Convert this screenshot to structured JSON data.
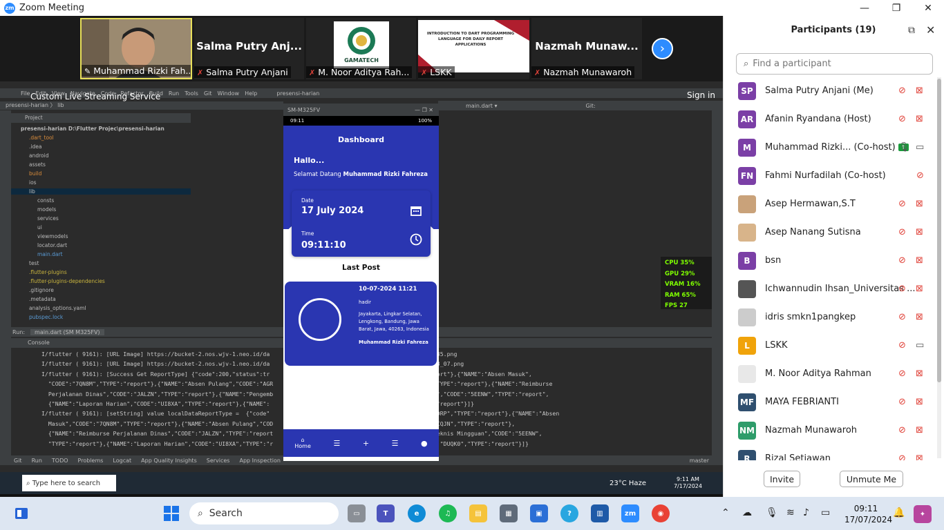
{
  "window": {
    "title": "Zoom Meeting",
    "controls": [
      "—",
      "❐",
      "✕"
    ]
  },
  "video_strip": {
    "tiles": [
      {
        "name": "Muhammad Rizki Fah...",
        "muted": false,
        "big": ""
      },
      {
        "name": "Salma Putry Anjani",
        "muted": true,
        "big": "Salma Putry Anj..."
      },
      {
        "name": "M. Noor Aditya Rah...",
        "muted": true,
        "big": ""
      },
      {
        "name": "LSKK",
        "muted": true,
        "big": ""
      },
      {
        "name": "Nazmah Munawaroh",
        "muted": true,
        "big": "Nazmah  Munaw..."
      }
    ],
    "gamatech_text": "GAMATECH",
    "slide_text": "INTRODUCTION TO DART PROGRAMMING LANGUAGE FOR DAILY REPORT APPLICATIONS"
  },
  "share": {
    "live_label": "Custom Live Streaming Service",
    "signin": "Sign in",
    "ide_menu": [
      "File",
      "Edit",
      "View",
      "Navigate",
      "Code",
      "Refactor",
      "Build",
      "Run",
      "Tools",
      "Git",
      "Window",
      "Help",
      "presensi-harian"
    ],
    "ide_path": "presensi-harian  〉 lib",
    "project_header": "Project",
    "tree": [
      "presensi-harian  D:\\Flutter Projec\\presensi-harian",
      ".dart_tool",
      ".idea",
      "android",
      "assets",
      "build",
      "ios",
      "lib",
      "consts",
      "models",
      "services",
      "ui",
      "viewmodels",
      "locator.dart",
      "main.dart",
      "test",
      ".flutter-plugins",
      ".flutter-plugins-dependencies",
      ".gitignore",
      ".metadata",
      "analysis_options.yaml",
      "pubspec.lock"
    ],
    "toolbar": [
      "main.dart ▾",
      "Git:"
    ],
    "perf": {
      "cpu": "CPU  35%",
      "gpu": "GPU  29%",
      "vram": "VRAM  16%",
      "ram": "RAM  65%",
      "fps": "FPS  27"
    },
    "run_tab": "Run:",
    "run_file": "main.dart (SM M325FV)",
    "console_tab": "Console",
    "console_lines": [
      "I/flutter ( 9161): [URL Image] https://bucket-2.nos.wjv-1.neo.id/da                                          _24_09_35.png",
      "I/flutter ( 9161): [URL Image] https://bucket-2.nos.wjv-1.neo.id/da                                          24_10_23_07.png",
      "I/flutter ( 9161): [Success Get ReportType] {\"code\":200,\"status\":tr             nas Luar\",\"CODE\":\"X9DRP\",\"TYPE\":\"report\"},{\"NAME\":\"Absen Masuk\",",
      "  \"CODE\":\"7QN8M\",\"TYPE\":\"report\"},{\"NAME\":\"Absen Pulang\",\"CODE\":\"AGR              Aplikasi Georima\",\"CODE\":\"OCQJN\",\"TYPE\":\"report\"},{\"NAME\":\"Reimburse",
      "  Perjalanan Dinas\",\"CODE\":\"JALZN\",\"TYPE\":\"report\"},{\"NAME\":\"Pengemb              t\"},{\"NAME\":\"Rapat Teknis Mingguan\",\"CODE\":\"5EENW\",\"TYPE\":\"report\",",
      "  {\"NAME\":\"Laporan Harian\",\"CODE\":\"UI8XA\",\"TYPE\":\"report\"},{\"NAME\":            t\"},{\"NAME\":\"\",\"CODE\":\"DUQK0\",\"TYPE\":\"report\"}]}",
      "I/flutter ( 9161): [setString] value localDataReportType =  {\"code\"             ta\":[{\"NAME\":\"Dinas Luar\",\"CODE\":\"X9DRP\",\"TYPE\":\"report\"},{\"NAME\":\"Absen",
      "  Masuk\",\"CODE\":\"7QN8M\",\"TYPE\":\"report\"},{\"NAME\":\"Absen Pulang\",\"COD              bangan Aplikasi Georima\",\"CODE\":\"OCQJN\",\"TYPE\":\"report\"},",
      "  {\"NAME\":\"Reimburse Perjalanan Dinas\",\"CODE\":\"JALZN\",\"TYPE\":\"report           Y4\",\"TYPE\":\"report\"},{\"NAME\":\"Rapat Teknis Mingguan\",\"CODE\":\"5EENW\",",
      "  \"TYPE\":\"report\"},{\"NAME\":\"Laporan Harian\",\"CODE\":\"UI8XA\",\"TYPE\":\"r          OP\",\"TYPE\":\"report\"},{\"NAME\":\"\",\"CODE\":\"DUQK0\",\"TYPE\":\"report\"}]}"
    ],
    "statusbar": [
      "Git",
      "Run",
      "TODO",
      "Problems",
      "Logcat",
      "App Quality Insights",
      "Services",
      "App Inspection"
    ],
    "statusbar_right": "master",
    "inner_taskbar": {
      "search": "Type here to search",
      "weather": "23°C  Haze",
      "time": "9:11 AM",
      "date": "7/17/2024"
    }
  },
  "phone": {
    "window_title": "SM-M325FV",
    "status_time": "09:11",
    "battery": "100%",
    "app_title": "Dashboard",
    "hallo": "Hallo...",
    "welcome": "Selamat Datang",
    "user": "Muhammad Rizki Fahreza",
    "date_label": "Date",
    "date_value": "17 July 2024",
    "time_label": "Time",
    "time_value": "09:11:10",
    "last_post": "Last Post",
    "post": {
      "datetime": "10-07-2024 11:21",
      "status": "hadir",
      "address": "Jayakarta, Lingkar Selatan, Lengkong, Bandung, Jawa Barat, Jawa, 40263, Indonesia",
      "author": "Muhammad Rizki Fahreza"
    },
    "nav": {
      "home": "Home"
    }
  },
  "participants": {
    "title": "Participants (19)",
    "search_placeholder": "Find a participant",
    "list": [
      {
        "initials": "SP",
        "color": "#7b3fa6",
        "name": "Salma Putry Anjani (Me)",
        "mic": "muted",
        "cam": "off"
      },
      {
        "initials": "AR",
        "color": "#7b3fa6",
        "name": "Afanin Ryandana (Host)",
        "mic": "muted",
        "cam": "off"
      },
      {
        "initials": "M",
        "color": "#7b3fa6",
        "name": "Muhammad Rizki... (Co-host)",
        "mic": "on",
        "cam": "on"
      },
      {
        "initials": "FN",
        "color": "#7b3fa6",
        "name": "Fahmi Nurfadilah (Co-host)",
        "mic": "muted",
        "cam": "none"
      },
      {
        "initials": "",
        "color": "#c9a27a",
        "name": "Asep Hermawan,S.T",
        "mic": "muted",
        "cam": "off"
      },
      {
        "initials": "",
        "color": "#d8b48a",
        "name": "Asep Nanang Sutisna",
        "mic": "muted",
        "cam": "off"
      },
      {
        "initials": "B",
        "color": "#7b3fa6",
        "name": "bsn",
        "mic": "muted",
        "cam": "off"
      },
      {
        "initials": "",
        "color": "#555555",
        "name": "Ichwannudin Ihsan_Universitas ...",
        "mic": "muted",
        "cam": "off"
      },
      {
        "initials": "",
        "color": "#cccccc",
        "name": "idris smkn1pangkep",
        "mic": "muted",
        "cam": "off"
      },
      {
        "initials": "L",
        "color": "#f0a30a",
        "name": "LSKK",
        "mic": "muted",
        "cam": "on"
      },
      {
        "initials": "",
        "color": "#e8e8e8",
        "name": "M. Noor Aditya Rahman",
        "mic": "muted",
        "cam": "off"
      },
      {
        "initials": "MF",
        "color": "#2f4f6f",
        "name": "MAYA FEBRIANTI",
        "mic": "muted",
        "cam": "off"
      },
      {
        "initials": "NM",
        "color": "#2e9c6a",
        "name": "Nazmah Munawaroh",
        "mic": "muted",
        "cam": "off"
      },
      {
        "initials": "R",
        "color": "#2f4f6f",
        "name": "Rizal Setiawan",
        "mic": "muted",
        "cam": "off"
      }
    ],
    "invite": "Invite",
    "unmute_me": "Unmute Me"
  },
  "taskbar": {
    "search": "Search",
    "time": "09:11",
    "date": "17/07/2024"
  }
}
